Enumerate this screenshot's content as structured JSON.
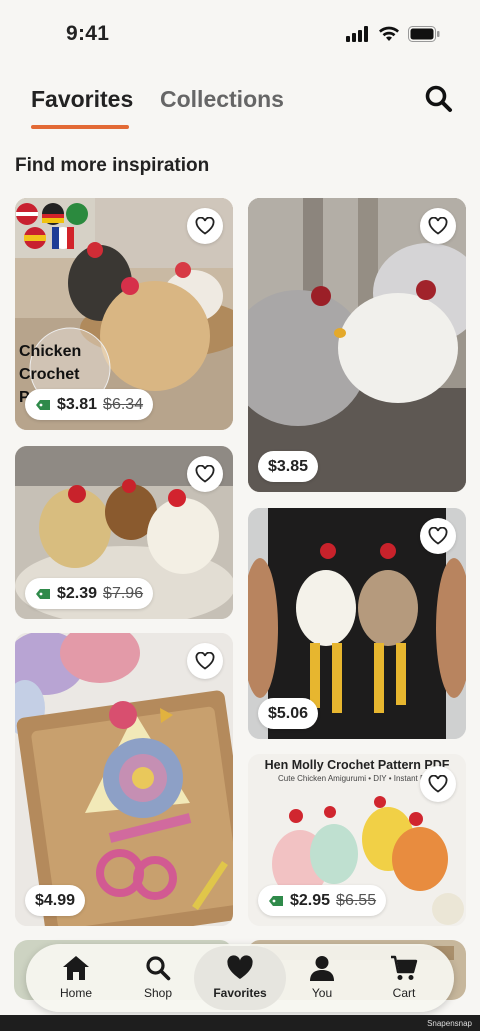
{
  "status_bar": {
    "time": "9:41"
  },
  "tabs": [
    {
      "label": "Favorites",
      "active": true
    },
    {
      "label": "Collections",
      "active": false
    }
  ],
  "section_title": "Find more inspiration",
  "cards": [
    {
      "price": "$3.81",
      "original_price": "$6.34",
      "on_sale": true,
      "overlay": [
        "Chicken",
        "Crochet",
        "P"
      ]
    },
    {
      "price": "$3.85",
      "original_price": null,
      "on_sale": false
    },
    {
      "price": "$2.39",
      "original_price": "$7.96",
      "on_sale": true
    },
    {
      "price": "$5.06",
      "original_price": null,
      "on_sale": false
    },
    {
      "price": "$4.99",
      "original_price": null,
      "on_sale": false
    },
    {
      "price": "$2.95",
      "original_price": "$6.55",
      "on_sale": true,
      "title": "Hen Molly Crochet Pattern PDF",
      "subtitle": "Cute Chicken Amigurumi • DIY • Instant Dow"
    }
  ],
  "nav": [
    {
      "label": "Home",
      "icon": "home-icon"
    },
    {
      "label": "Shop",
      "icon": "search-icon"
    },
    {
      "label": "Favorites",
      "icon": "heart-icon",
      "active": true
    },
    {
      "label": "You",
      "icon": "person-icon"
    },
    {
      "label": "Cart",
      "icon": "cart-icon"
    }
  ],
  "colors": {
    "accent": "#e36a35",
    "sale_tag": "#2f8a4a",
    "background": "#f7f6f3"
  },
  "watermark": "Snapensnap"
}
